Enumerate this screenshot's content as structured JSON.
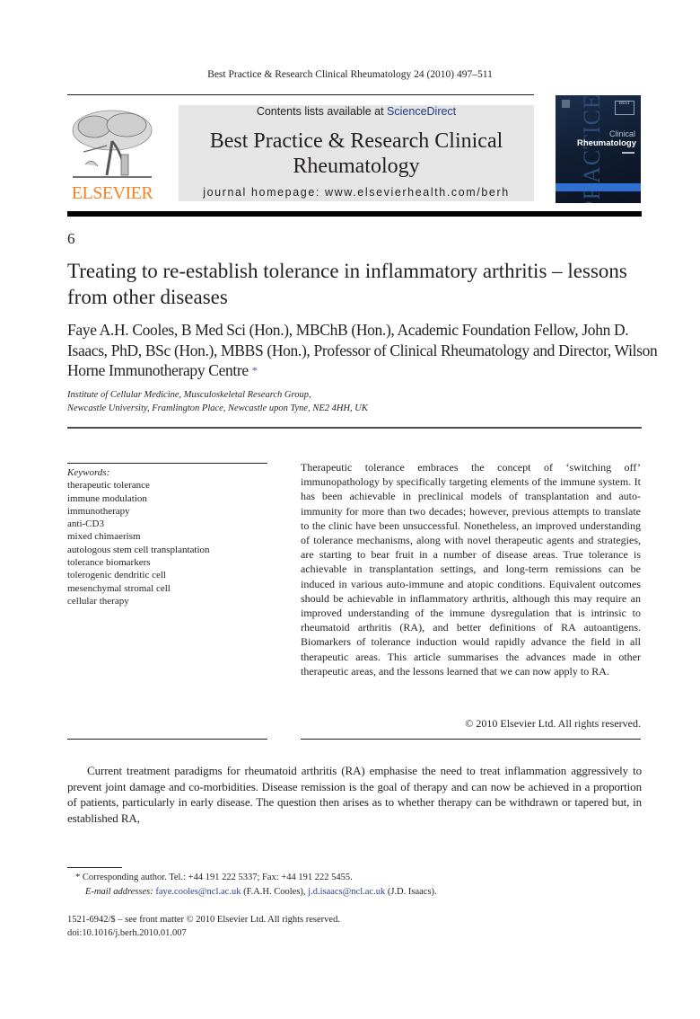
{
  "running_head": "Best Practice & Research Clinical Rheumatology 24 (2010) 497–511",
  "publisher": {
    "logo_icon": "elsevier-tree-icon",
    "name": "ELSEVIER"
  },
  "banner": {
    "contents_prefix": "Contents lists available at ",
    "contents_link": "ScienceDirect",
    "journal_title": "Best Practice & Research Clinical Rheumatology",
    "homepage": "journal homepage: www.elsevierhealth.com/berh"
  },
  "cover": {
    "series": "PRACTICE",
    "badge": "BEST",
    "subtitle": "Clinical",
    "title": "Rheumatology"
  },
  "article": {
    "chapter_number": "6",
    "title": "Treating to re-establish tolerance in inflammatory arthritis – lessons from other diseases",
    "authors": "Faye A.H. Cooles, B Med Sci (Hon.), MBChB (Hon.), Academic Foundation Fellow, John D. Isaacs, PhD, BSc (Hon.), MBBS (Hon.), Professor of Clinical Rheumatology and Director, Wilson Horne Immunotherapy Centre",
    "corresponding_marker": "*",
    "affiliation_line1": "Institute of Cellular Medicine, Musculoskeletal Research Group,",
    "affiliation_line2": "Newcastle University, Framlington Place, Newcastle upon Tyne, NE2 4HH, UK"
  },
  "keywords": {
    "label": "Keywords:",
    "items": [
      "therapeutic tolerance",
      "immune modulation",
      "immunotherapy",
      "anti-CD3",
      "mixed chimaerism",
      "autologous stem cell transplantation",
      "tolerance biomarkers",
      "tolerogenic dendritic cell",
      "mesenchymal stromal cell",
      "cellular therapy"
    ]
  },
  "abstract": {
    "text": "Therapeutic tolerance embraces the concept of ‘switching off’ immunopathology by specifically targeting elements of the immune system. It has been achievable in preclinical models of transplantation and auto-immunity for more than two decades; however, previous attempts to translate to the clinic have been unsuccessful. Nonetheless, an improved understanding of tolerance mechanisms, along with novel therapeutic agents and strategies, are starting to bear fruit in a number of disease areas. True tolerance is achievable in transplantation settings, and long-term remissions can be induced in various auto-immune and atopic conditions. Equivalent outcomes should be achievable in inflammatory arthritis, although this may require an improved understanding of the immune dysregulation that is intrinsic to rheumatoid arthritis (RA), and better definitions of RA autoantigens. Biomarkers of tolerance induction would rapidly advance the field in all therapeutic areas. This article summarises the advances made in other therapeutic areas, and the lessons learned that we can now apply to RA.",
    "copyright": "© 2010 Elsevier Ltd. All rights reserved."
  },
  "body": {
    "paragraph1": "Current treatment paradigms for rheumatoid arthritis (RA) emphasise the need to treat inflammation aggressively to prevent joint damage and co-morbidities. Disease remission is the goal of therapy and can now be achieved in a proportion of patients, particularly in early disease. The question then arises as to whether therapy can be withdrawn or tapered but, in established RA,"
  },
  "footnote": {
    "marker": "*",
    "corresponding": "Corresponding author. Tel.: +44 191 222 5337; Fax: +44 191 222 5455.",
    "email_label": "E-mail addresses:",
    "email1": "faye.cooles@ncl.ac.uk",
    "email1_owner": "(F.A.H. Cooles),",
    "email2": "j.d.isaacs@ncl.ac.uk",
    "email2_owner": "(J.D. Isaacs)."
  },
  "front_matter": {
    "issn_line": "1521-6942/$ – see front matter © 2010 Elsevier Ltd. All rights reserved.",
    "doi": "doi:10.1016/j.berh.2010.01.007"
  },
  "colors": {
    "elsevier_orange": "#f58220",
    "link_blue": "#1f3c88",
    "banner_gray": "#e5e5e5",
    "cover_navy": "#1b2f4d",
    "cover_band": "#2f6fd1"
  }
}
